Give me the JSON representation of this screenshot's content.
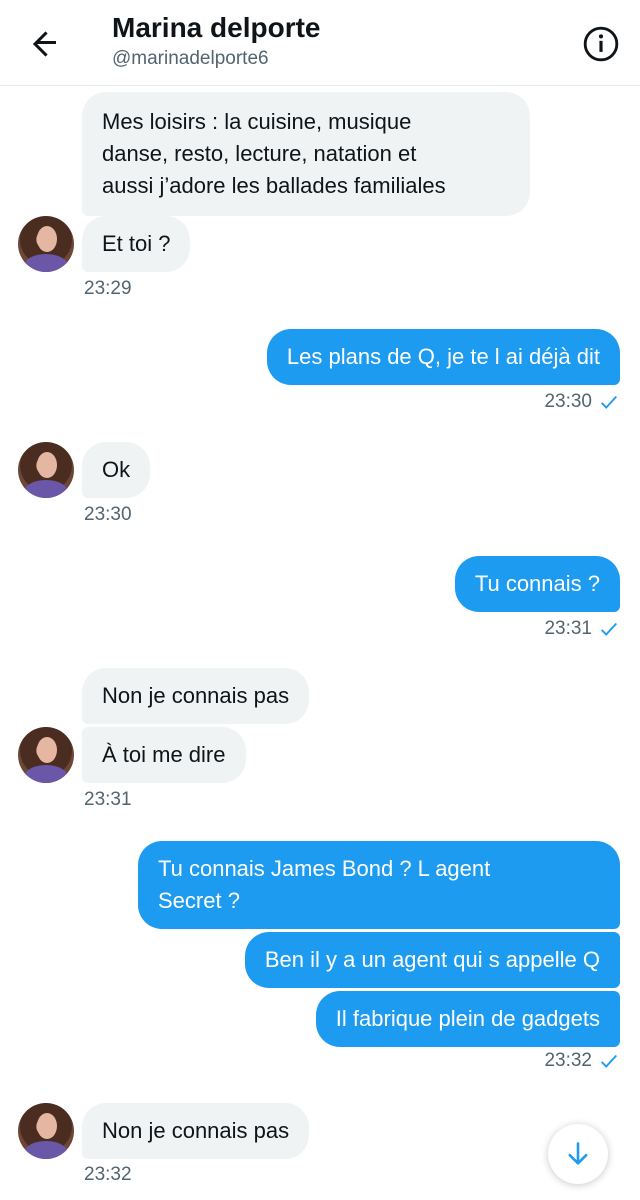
{
  "header": {
    "title": "Marina delporte",
    "handle": "@marinadelporte6"
  },
  "messages": [
    {
      "id": 1,
      "direction": "incoming",
      "lines": [
        "Mes loisirs : la cuisine, musique",
        "danse, resto, lecture, natation et",
        "aussi j’adore les ballades familiales"
      ]
    },
    {
      "id": 2,
      "direction": "incoming",
      "text": "Et toi ?",
      "time": "23:29"
    },
    {
      "id": 3,
      "direction": "outgoing",
      "text": "Les plans de Q, je te l ai déjà dit",
      "time": "23:30"
    },
    {
      "id": 4,
      "direction": "incoming",
      "text": "Ok",
      "time": "23:30"
    },
    {
      "id": 5,
      "direction": "outgoing",
      "text": "Tu connais ?",
      "time": "23:31"
    },
    {
      "id": 6,
      "direction": "incoming",
      "text": "Non je connais pas"
    },
    {
      "id": 7,
      "direction": "incoming",
      "text": "À toi me dire",
      "time": "23:31"
    },
    {
      "id": 8,
      "direction": "outgoing",
      "lines": [
        "Tu connais James Bond ? L agent",
        "Secret ?"
      ]
    },
    {
      "id": 9,
      "direction": "outgoing",
      "text": "Ben il y a un agent qui s appelle Q"
    },
    {
      "id": 10,
      "direction": "outgoing",
      "text": "Il fabrique plein de gadgets",
      "time": "23:32"
    },
    {
      "id": 11,
      "direction": "incoming",
      "text": "Non je connais pas",
      "time": "23:32"
    }
  ],
  "colors": {
    "accent": "#1d9bf0",
    "incoming_bubble": "#eff3f4",
    "secondary_text": "#536471"
  },
  "icons": {
    "back": "arrow-left-icon",
    "info": "info-icon",
    "sent": "check-icon",
    "scroll": "arrow-down-icon"
  }
}
